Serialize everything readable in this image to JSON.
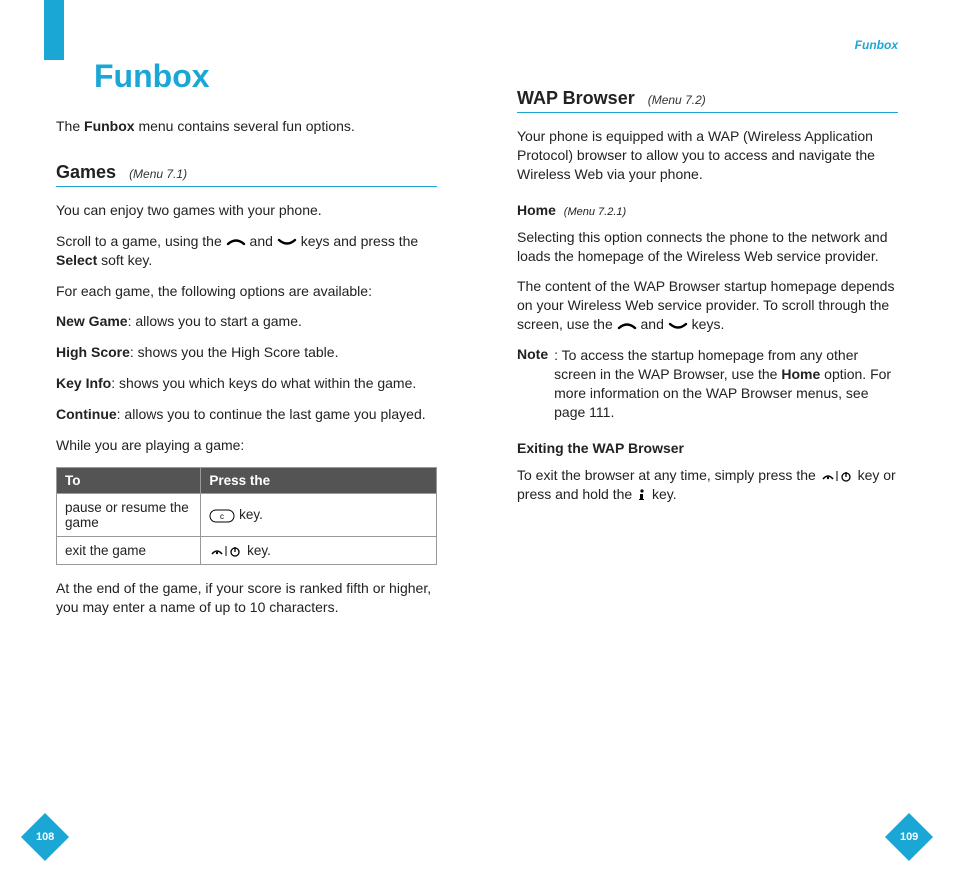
{
  "header": {
    "running_head": "Funbox"
  },
  "chapter": {
    "title": "Funbox"
  },
  "left": {
    "intro_pre": "The ",
    "intro_bold": "Funbox",
    "intro_post": " menu contains several fun options.",
    "games": {
      "heading": "Games",
      "menu_ref": "(Menu 7.1)",
      "p1": "You can enjoy two games with your phone.",
      "p2_pre": "Scroll to a game, using the ",
      "p2_mid": " and ",
      "p2_post": "  keys and press the ",
      "p2_bold": "Select",
      "p2_end": " soft key.",
      "p3": "For each game, the following options are available:",
      "opts": {
        "new_game_b": "New Game",
        "new_game_t": ": allows you to start a game.",
        "high_score_b": "High Score",
        "high_score_t": ": shows you the High Score table.",
        "key_info_b": "Key Info",
        "key_info_t": ": shows you which keys do what within the game.",
        "continue_b": "Continue",
        "continue_t": ": allows you to continue the last game you played."
      },
      "p4": "While you are playing a game:",
      "table": {
        "h1": "To",
        "h2": "Press the",
        "r1c1": "pause or resume the game",
        "r1c2": " key.",
        "r2c1": "exit the game",
        "r2c2": "  key."
      },
      "p5": "At the end of the game, if your score is ranked fifth or higher, you may enter a name of up to 10 characters."
    }
  },
  "right": {
    "wap": {
      "heading": "WAP Browser",
      "menu_ref": "(Menu 7.2)",
      "p1": "Your phone is equipped with a WAP (Wireless Application Protocol) browser to allow you to access and navigate the Wireless Web via your phone.",
      "home_heading": "Home",
      "home_ref": "(Menu 7.2.1)",
      "p2": "Selecting this option connects the phone to the network and loads the homepage of the Wireless Web service provider.",
      "p3_pre": "The content of the WAP Browser startup homepage depends on your Wireless Web service provider. To scroll through the screen, use the ",
      "p3_mid": " and ",
      "p3_post": " keys.",
      "note_label": "Note",
      "note_body_pre": ": To access the startup homepage from any other screen in the WAP Browser, use the ",
      "note_body_bold": "Home",
      "note_body_post": " option. For more information on the WAP Browser menus, see page 111.",
      "exit_heading": "Exiting the WAP Browser",
      "p4_pre": "To exit the browser at any time, simply press the  ",
      "p4_mid": " key or press and hold the ",
      "p4_post": " key."
    }
  },
  "pages": {
    "left": "108",
    "right": "109"
  }
}
